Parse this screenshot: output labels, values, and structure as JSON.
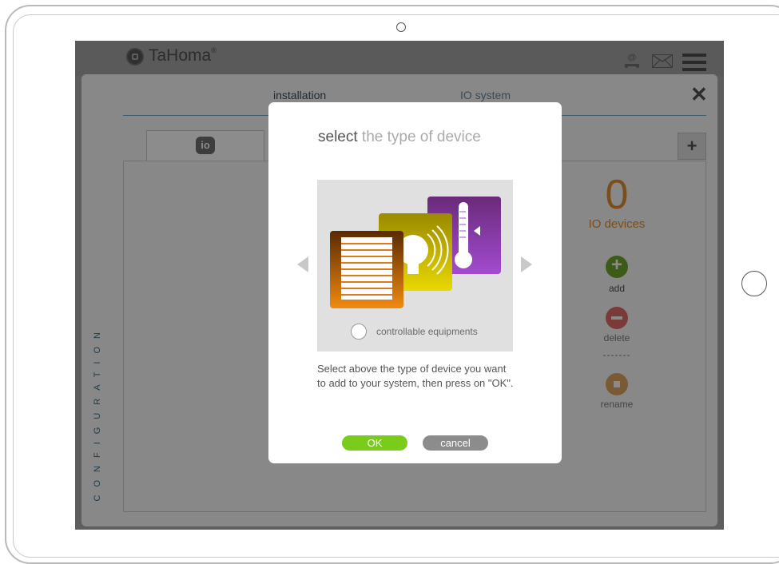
{
  "app": {
    "brand": "TaHoma",
    "brand_mark": "®"
  },
  "header": {
    "tabs": [
      {
        "label": "installation"
      },
      {
        "label": "IO system"
      }
    ],
    "io_tab_label": "io"
  },
  "sidebar": {
    "vertical_label": "CONFIGURATION"
  },
  "summary": {
    "count": "0",
    "count_label": "IO devices"
  },
  "actions": {
    "add": "add",
    "delete": "delete",
    "separator": "-------",
    "rename": "rename"
  },
  "modal": {
    "title_strong": "select",
    "title_light": " the type of device",
    "option_label": "controllable equipments",
    "description": "Select above the type of device you want to add to your system, then press on \"OK\".",
    "ok_label": "OK",
    "cancel_label": "cancel"
  },
  "colors": {
    "accent_orange": "#e57d16",
    "ok_green": "#7acc1a",
    "add_green": "#5aa81e",
    "delete_red": "#cc4a46",
    "screen_dark": "#5e5e5e"
  },
  "icons": {
    "logo": "home-icon",
    "account": "at-user-icon",
    "messages": "mail-icon",
    "menu": "hamburger-menu-icon",
    "close": "close-icon",
    "add_device": "plus-icon",
    "device_types": [
      "shutter-icon",
      "bulb-icon",
      "thermometer-icon"
    ]
  }
}
